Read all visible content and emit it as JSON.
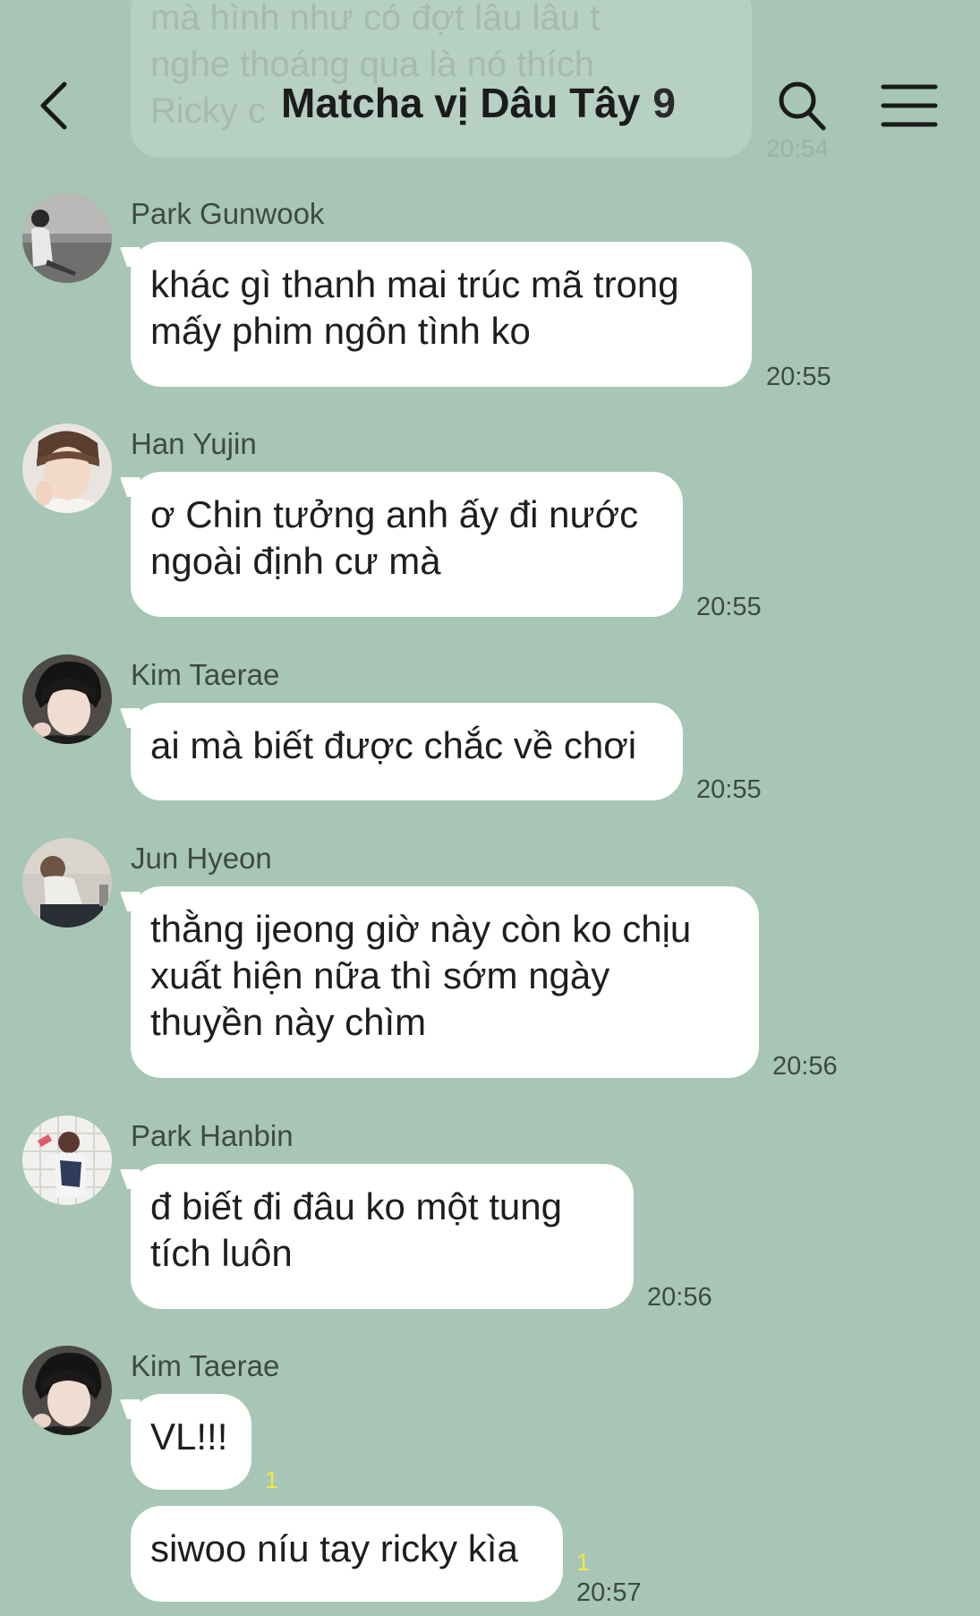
{
  "header": {
    "title": "Matcha vị Dâu Tây",
    "member_count": "9",
    "back_icon": "chevron-left-icon",
    "search_icon": "search-icon",
    "menu_icon": "menu-icon"
  },
  "ghost_message": {
    "lines": [
      "mà hình như có đợt lâu lâu t",
      "nghe thoáng qua là nó thích",
      "Ricky c"
    ],
    "time": "20:54"
  },
  "messages": [
    {
      "sender": "Park Gunwook",
      "lines": [
        "khác gì thanh mai trúc mã trong",
        "mấy phim ngôn tình ko"
      ],
      "time": "20:55"
    },
    {
      "sender": "Han Yujin",
      "lines": [
        "ơ Chin tưởng anh ấy đi nước",
        "ngoài định cư mà"
      ],
      "time": "20:55"
    },
    {
      "sender": "Kim Taerae",
      "lines": [
        "ai mà biết được chắc về chơi"
      ],
      "time": "20:55"
    },
    {
      "sender": "Jun Hyeon",
      "lines": [
        "thằng ijeong giờ này còn ko chịu",
        "xuất hiện nữa thì sớm ngày",
        "thuyền này chìm"
      ],
      "time": "20:56"
    },
    {
      "sender": "Park Hanbin",
      "lines": [
        "đ biết đi đâu ko một tung",
        "tích luôn"
      ],
      "time": "20:56"
    },
    {
      "sender": "Kim Taerae",
      "lines": [
        "VL!!!"
      ],
      "unread": "1"
    },
    {
      "lines": [
        "siwoo níu tay ricky kìa"
      ],
      "unread": "1",
      "time": "20:57"
    }
  ],
  "colors": {
    "background": "#a7c6b6",
    "bubble": "#ffffff",
    "unread": "#f3e83e"
  }
}
